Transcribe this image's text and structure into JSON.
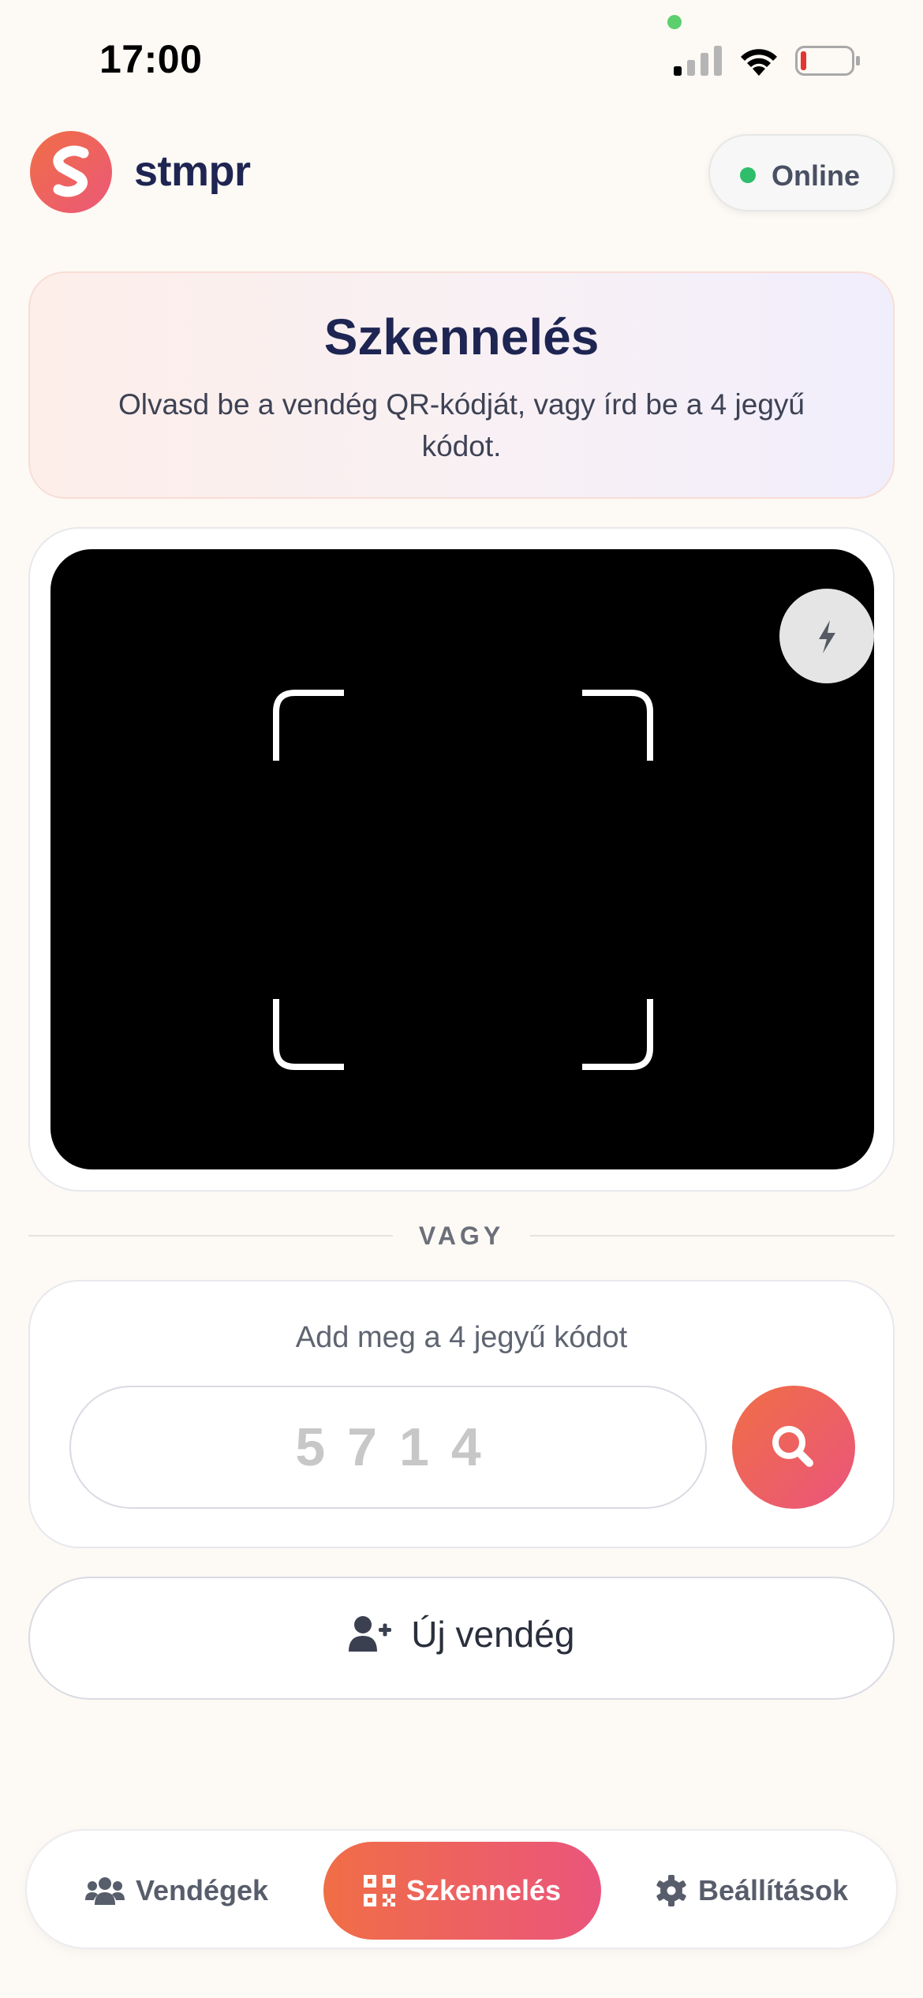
{
  "status_bar": {
    "time": "17:00",
    "icons": [
      "signal-icon",
      "wifi-icon",
      "battery-low-icon"
    ]
  },
  "header": {
    "brand": "stmpr",
    "status_label": "Online",
    "status_color": "#2ebd6b"
  },
  "scan_card": {
    "title": "Szkennelés",
    "description": "Olvasd be a vendég QR-kódját, vagy írd be a 4 jegyű kódot."
  },
  "scanner": {
    "flash_icon": "flash-icon"
  },
  "divider_label": "VAGY",
  "code_entry": {
    "prompt": "Add meg a 4 jegyű kódot",
    "placeholder": "5714",
    "submit_icon": "search-icon"
  },
  "new_guest_button": {
    "label": "Új vendég",
    "icon": "user-plus-icon"
  },
  "nav": {
    "items": [
      {
        "label": "Vendégek",
        "icon": "users-icon",
        "active": false
      },
      {
        "label": "Szkennelés",
        "icon": "qr-code-icon",
        "active": true
      },
      {
        "label": "Beállítások",
        "icon": "gear-icon",
        "active": false
      }
    ]
  },
  "colors": {
    "accent_start": "#f06e46",
    "accent_end": "#ea557c",
    "brand_text": "#1e2552",
    "background": "#fdf9f4"
  }
}
